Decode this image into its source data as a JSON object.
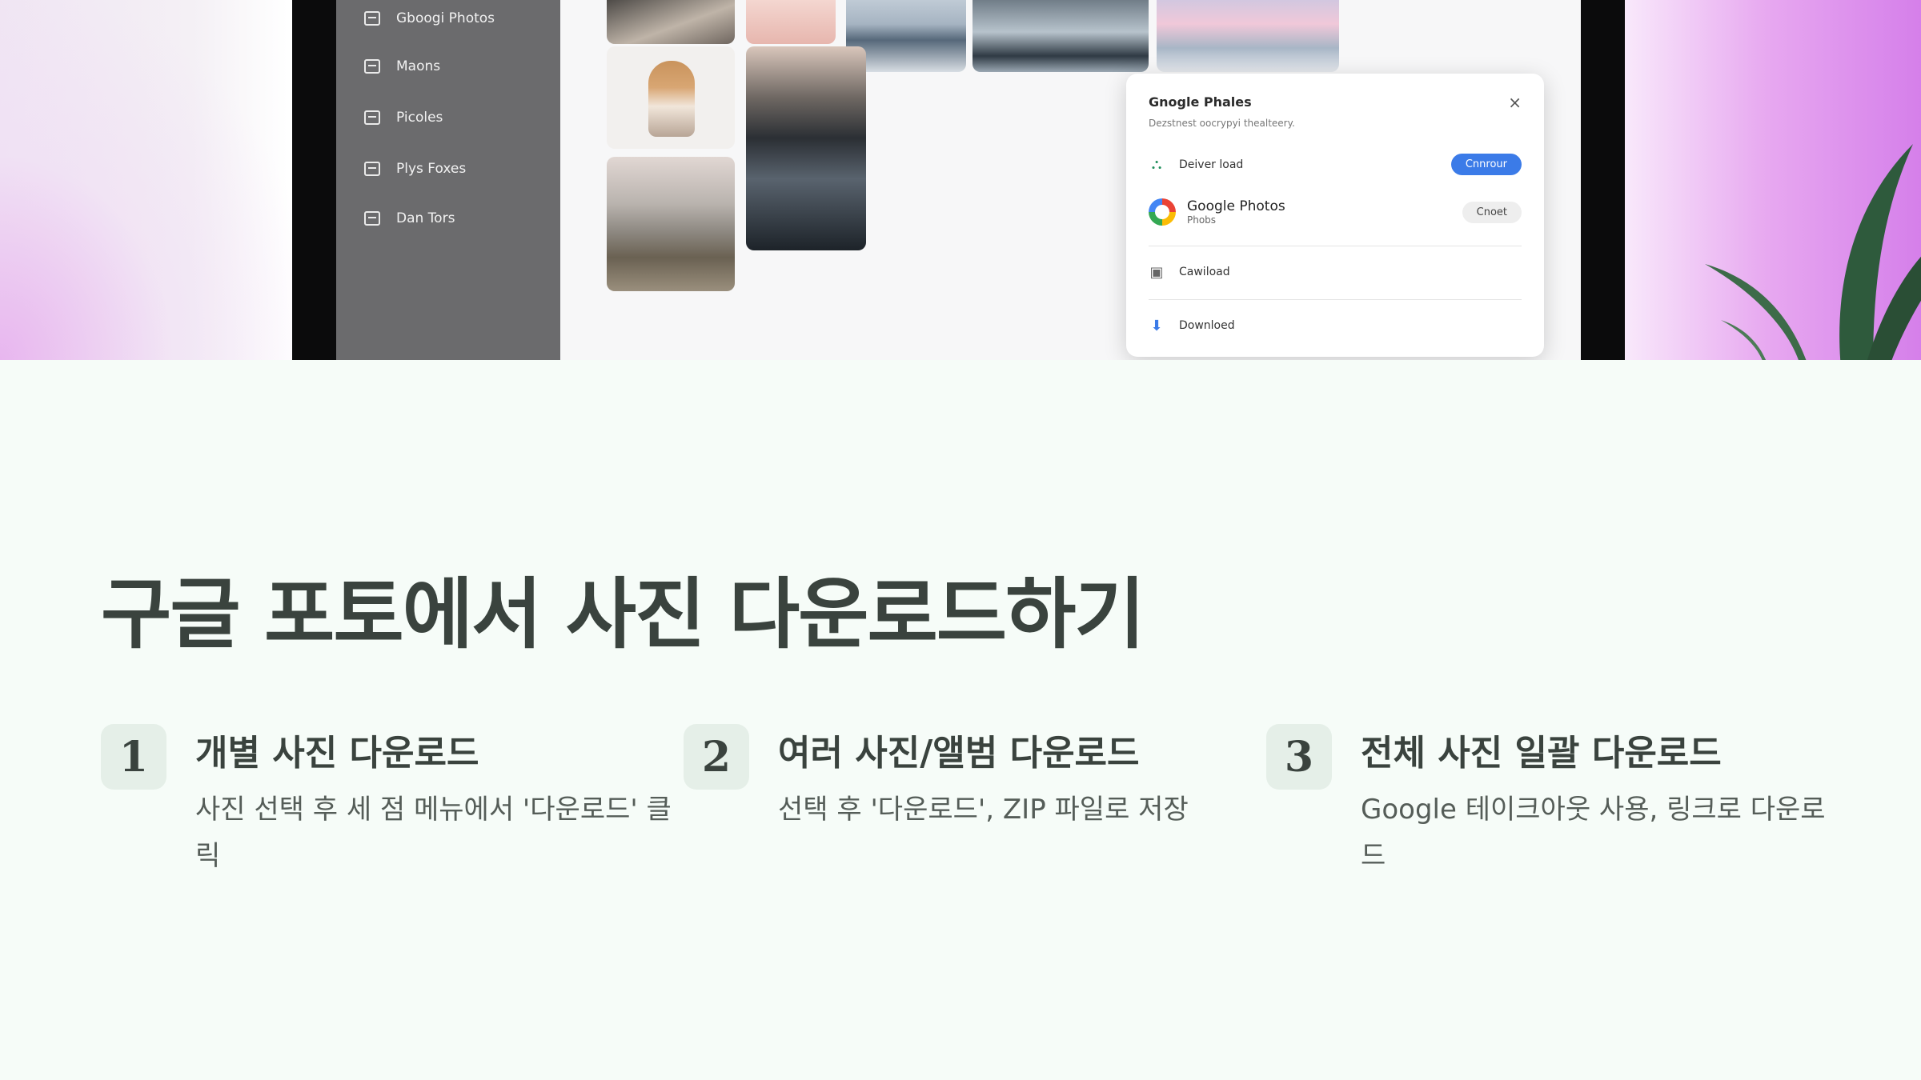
{
  "hero": {
    "sidebar_items": [
      {
        "label": "Gboogi Photos",
        "icon": "photos-icon"
      },
      {
        "label": "Maons",
        "icon": "albums-icon"
      },
      {
        "label": "Picoles",
        "icon": "people-icon"
      },
      {
        "label": "Plys Foxes",
        "icon": "places-icon"
      },
      {
        "label": "Dan Tors",
        "icon": "utilities-icon"
      }
    ],
    "dialog": {
      "title": "Gnogle Phales",
      "subtitle": "Dezstnest oocrypyi thealteery.",
      "close": "×",
      "rows": [
        {
          "label": "Deiver load",
          "button": "Cnnrour",
          "icon": "drive-icon"
        },
        {
          "label": "Google Photos",
          "sublabel": "Phobs",
          "button": "Cnoet",
          "icon": "google-logo"
        },
        {
          "label": "Cawiload",
          "icon": "device-icon"
        },
        {
          "label": "Downloed",
          "icon": "download-icon"
        }
      ]
    }
  },
  "title": "구글 포토에서 사진 다운로드하기",
  "steps": [
    {
      "number": "1",
      "title": "개별 사진 다운로드",
      "desc": "사진 선택 후 세 점 메뉴에서 '다운로드' 클릭"
    },
    {
      "number": "2",
      "title": "여러 사진/앨범 다운로드",
      "desc": "선택 후 '다운로드', ZIP 파일로 저장"
    },
    {
      "number": "3",
      "title": "전체 사진 일괄 다운로드",
      "desc": "Google 테이크아웃 사용, 링크로 다운로드"
    }
  ],
  "colors": {
    "accent": "#3b7be8",
    "text": "#3a433e",
    "badge_bg": "#e5efe8",
    "page_bg": "#f6fcf8"
  }
}
